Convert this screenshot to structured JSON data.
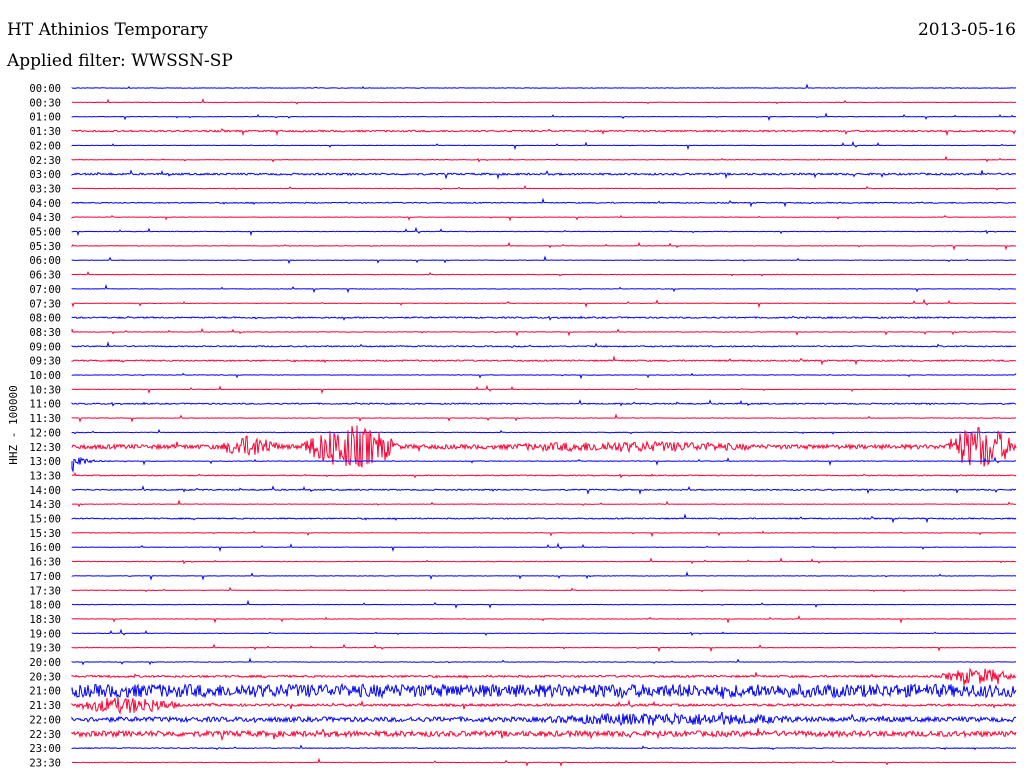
{
  "header": {
    "title": "HT Athinios Temporary",
    "date": "2013-05-16",
    "filter": "Applied filter: WWSSN-SP"
  },
  "chart_data": {
    "type": "line",
    "title": "HT Athinios Temporary",
    "ylabel": "HHZ - 100000",
    "row_labels": [
      "00:00",
      "00:30",
      "01:00",
      "01:30",
      "02:00",
      "02:30",
      "03:00",
      "03:30",
      "04:00",
      "04:30",
      "05:00",
      "05:30",
      "06:00",
      "06:30",
      "07:00",
      "07:30",
      "08:00",
      "08:30",
      "09:00",
      "09:30",
      "10:00",
      "10:30",
      "11:00",
      "11:30",
      "12:00",
      "12:30",
      "13:00",
      "13:30",
      "14:00",
      "14:30",
      "15:00",
      "15:30",
      "16:00",
      "16:30",
      "17:00",
      "17:30",
      "18:00",
      "18:30",
      "19:00",
      "19:30",
      "20:00",
      "20:30",
      "21:00",
      "21:30",
      "22:00",
      "22:30",
      "23:00",
      "23:30"
    ],
    "colors": [
      "#0000ff",
      "#ff0033"
    ],
    "grid": false,
    "legend": "none"
  }
}
